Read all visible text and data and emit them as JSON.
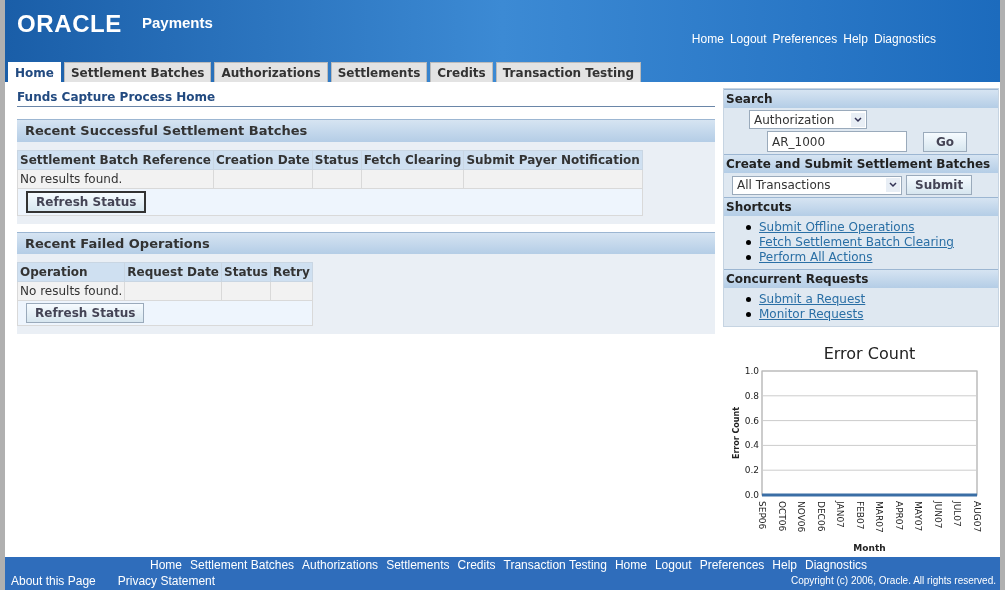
{
  "header": {
    "logo": "ORACLE",
    "product": "Payments",
    "global_links": [
      "Home",
      "Logout",
      "Preferences",
      "Help",
      "Diagnostics"
    ]
  },
  "tabs": [
    {
      "label": "Home",
      "selected": true
    },
    {
      "label": "Settlement Batches",
      "selected": false
    },
    {
      "label": "Authorizations",
      "selected": false
    },
    {
      "label": "Settlements",
      "selected": false
    },
    {
      "label": "Credits",
      "selected": false
    },
    {
      "label": "Transaction Testing",
      "selected": false
    }
  ],
  "page_title": "Funds Capture Process Home",
  "sections": [
    {
      "title": "Recent Successful Settlement Batches",
      "columns": [
        "Settlement Batch Reference",
        "Creation Date",
        "Status",
        "Fetch Clearing",
        "Submit Payer Notification"
      ],
      "empty_text": "No results found.",
      "button": "Refresh Status",
      "button_focused": true
    },
    {
      "title": "Recent Failed Operations",
      "columns": [
        "Operation",
        "Request Date",
        "Status",
        "Retry"
      ],
      "empty_text": "No results found.",
      "button": "Refresh Status",
      "button_focused": false
    }
  ],
  "sidebar": {
    "search": {
      "title": "Search",
      "type_value": "Authorization",
      "query_value": "AR_1000",
      "button": "Go"
    },
    "create": {
      "title": "Create and Submit Settlement Batches",
      "select_value": "All Transactions",
      "button": "Submit"
    },
    "shortcuts": {
      "title": "Shortcuts",
      "links": [
        "Submit Offline Operations",
        "Fetch Settlement Batch Clearing",
        "Perform All Actions"
      ]
    },
    "requests": {
      "title": "Concurrent Requests",
      "links": [
        "Submit a Request",
        "Monitor Requests"
      ]
    }
  },
  "chart": {
    "chart_data": {
      "type": "line",
      "title": "Error Count",
      "xlabel": "Month",
      "ylabel": "Error Count",
      "categories": [
        "SEP06",
        "OCT06",
        "NOV06",
        "DEC06",
        "JAN07",
        "FEB07",
        "MAR07",
        "APR07",
        "MAY07",
        "JUN07",
        "JUL07",
        "AUG07"
      ],
      "grid": true,
      "series": [
        {
          "color": "#3a6ea5",
          "values": [
            0,
            0,
            0,
            0,
            0,
            0,
            0,
            0,
            0,
            0,
            0,
            0
          ]
        }
      ],
      "ylim": [
        0,
        1
      ],
      "yticks": [
        {
          "value": 0,
          "label": "0.0"
        },
        {
          "value": 0.2,
          "label": "0.2"
        },
        {
          "value": 0.4,
          "label": "0.4"
        },
        {
          "value": 0.6,
          "label": "0.6"
        },
        {
          "value": 0.8,
          "label": "0.8"
        },
        {
          "value": 1,
          "label": "1.0"
        }
      ]
    }
  },
  "footer": {
    "links": [
      "Home",
      "Settlement Batches",
      "Authorizations",
      "Settlements",
      "Credits",
      "Transaction Testing",
      "Home",
      "Logout",
      "Preferences",
      "Help",
      "Diagnostics"
    ],
    "bottom_links": [
      "About this Page",
      "Privacy Statement"
    ],
    "copyright": "Copyright (c) 2006, Oracle. All rights reserved."
  }
}
